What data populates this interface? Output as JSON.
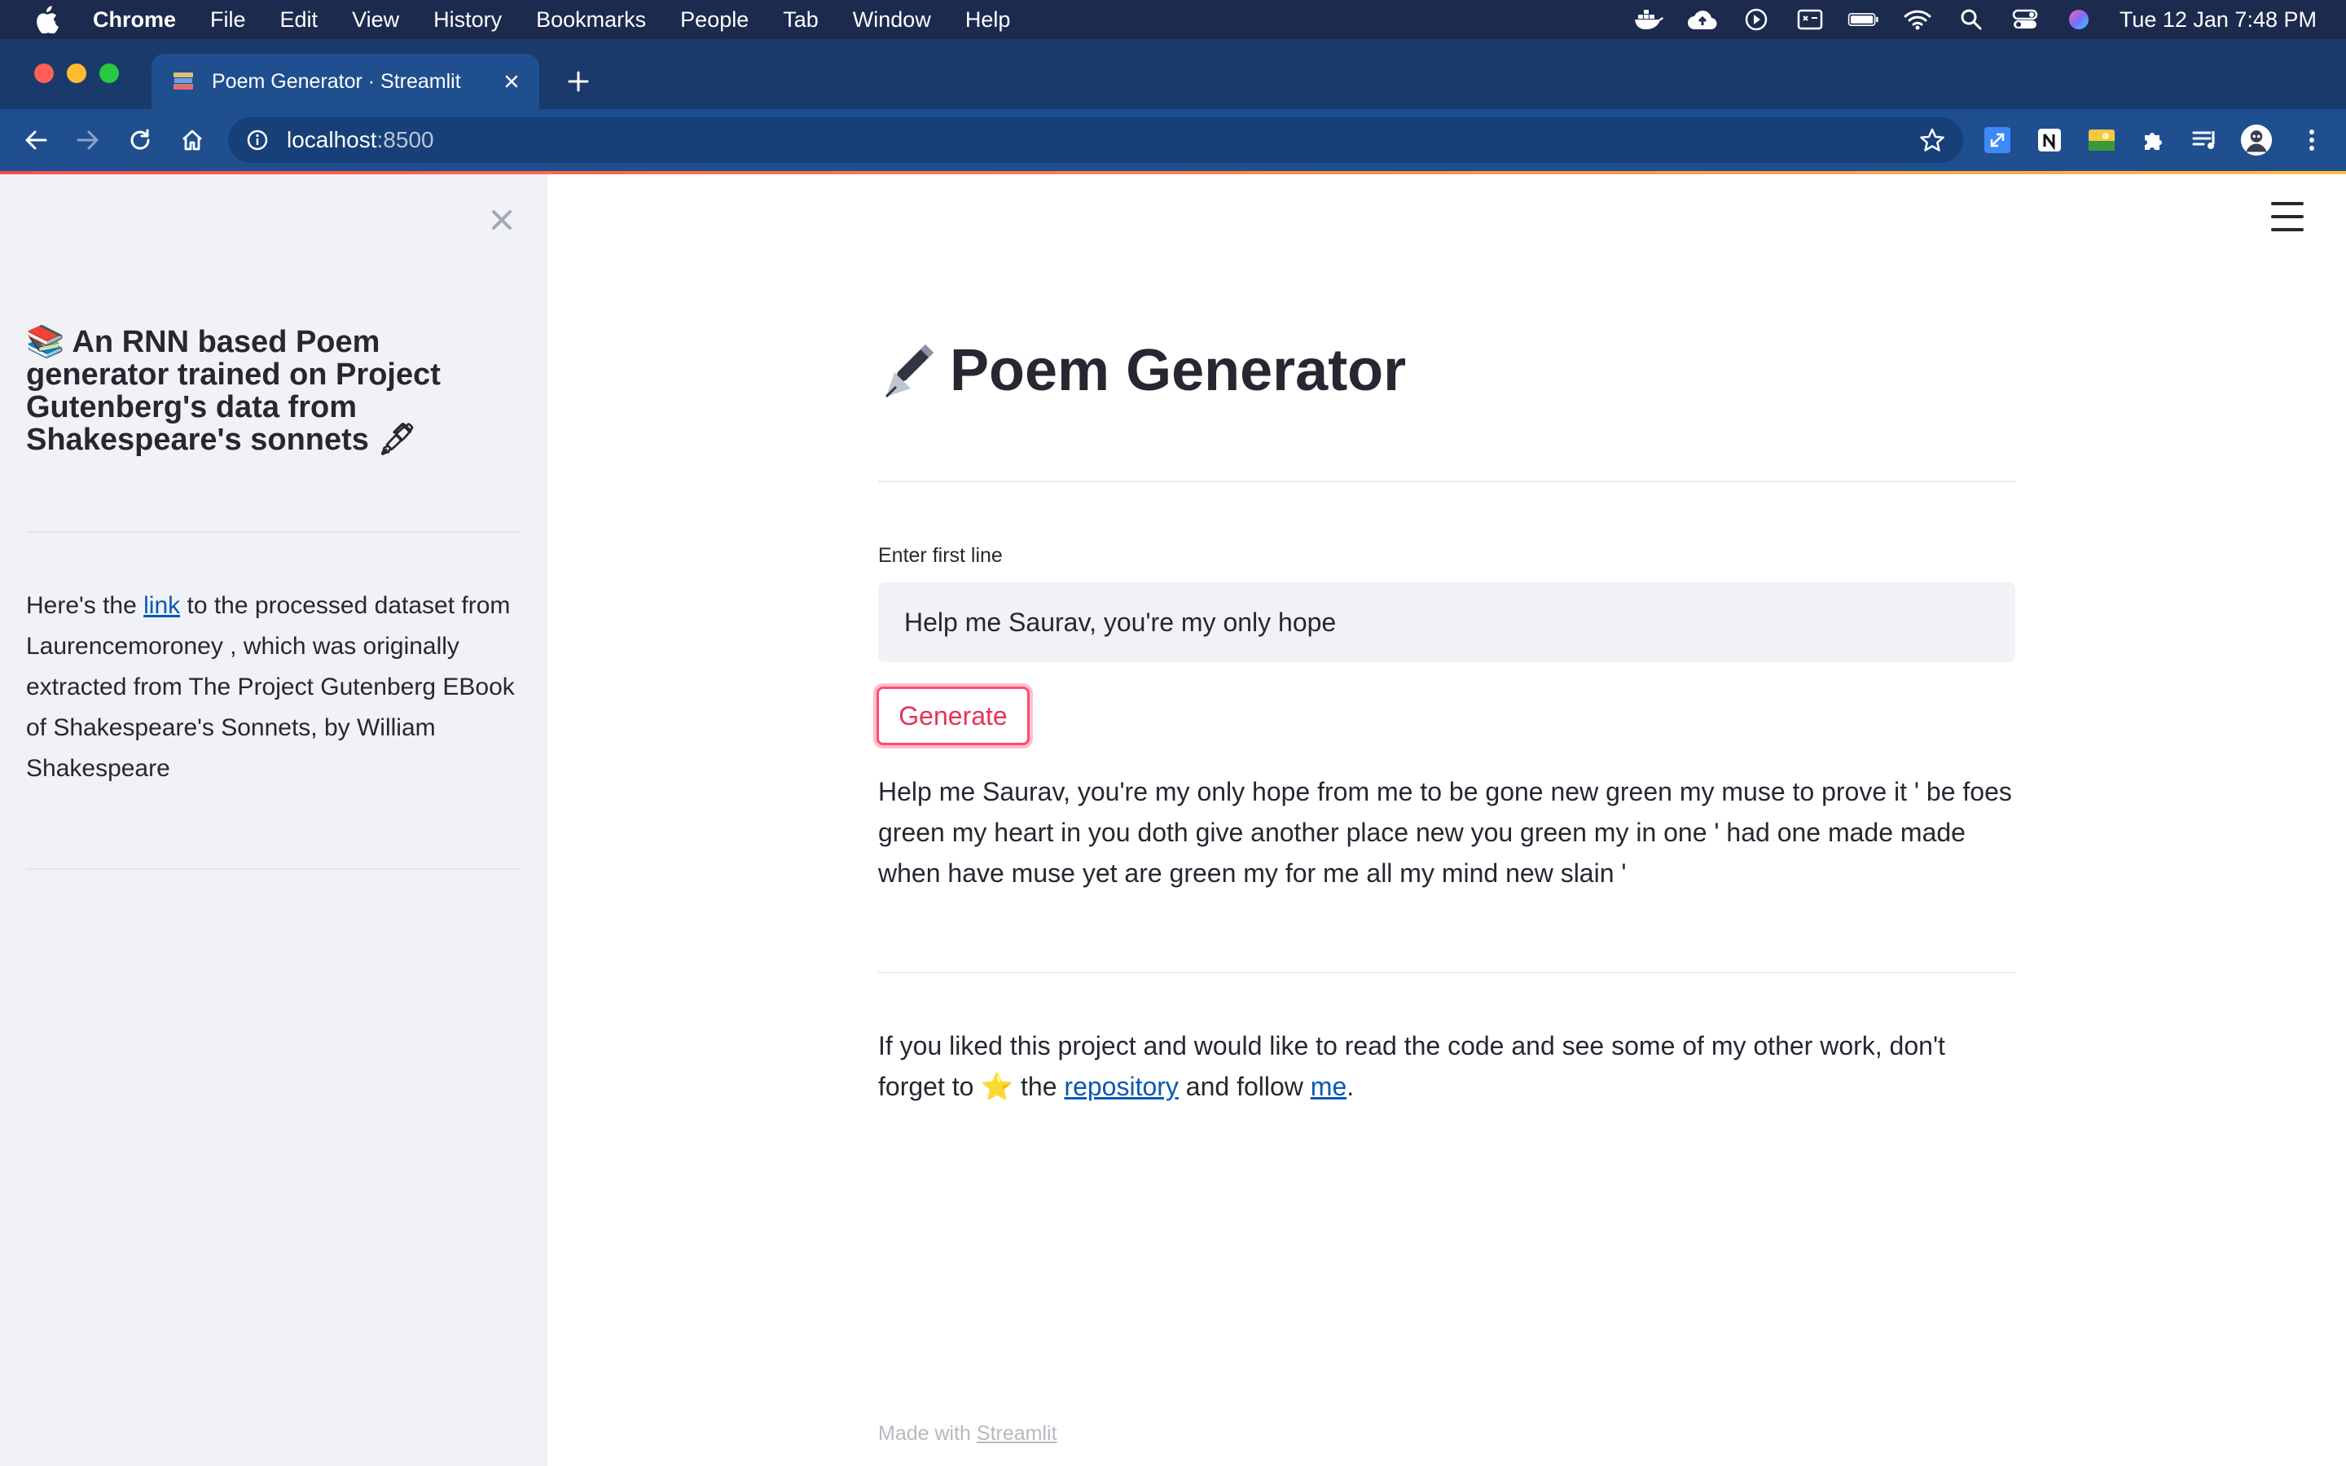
{
  "menubar": {
    "app_name": "Chrome",
    "items": [
      "File",
      "Edit",
      "View",
      "History",
      "Bookmarks",
      "People",
      "Tab",
      "Window",
      "Help"
    ],
    "clock": "Tue 12 Jan  7:48 PM"
  },
  "browser": {
    "tab_title": "Poem Generator · Streamlit",
    "url_host": "localhost",
    "url_port": ":8500"
  },
  "sidebar": {
    "title_emoji": "📚",
    "title_text": "An RNN based Poem generator trained on Project Gutenberg's data from Shakespeare's sonnets",
    "title_suffix_emoji": "🖋",
    "body_prefix": "Here's the ",
    "body_link": "link",
    "body_suffix": " to the processed dataset from Laurencemoroney , which was originally extracted from The Project Gutenberg EBook of Shakespeare's Sonnets, by William Shakespeare"
  },
  "main": {
    "title": "Poem Generator",
    "input_label": "Enter first line",
    "input_value": "Help me Saurav, you're my only hope",
    "generate_label": "Generate",
    "poem_output": "Help me Saurav, you're my only hope from me to be gone new green my muse to prove it ' be foes green my heart in you doth give another place new you green my in one ' had one made made when have muse yet are green my for me all my mind new slain '",
    "footer_prefix": "If you liked this project and would like to read the code and see some of my other work, don't forget to ",
    "footer_star": "⭐",
    "footer_mid1": " the ",
    "footer_repo_link": "repository",
    "footer_mid2": " and follow ",
    "footer_me_link": "me",
    "footer_end": ".",
    "made_with_prefix": "Made with ",
    "made_with_link": "Streamlit"
  },
  "colors": {
    "primary": "#ff4b4b",
    "sidebar_bg": "#f0f2f6",
    "link": "#0a58b5",
    "browser_chrome": "#1f4f8f"
  }
}
